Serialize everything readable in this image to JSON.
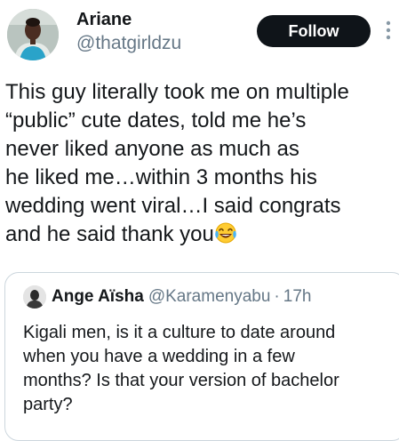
{
  "author": {
    "display_name": "Ariane",
    "handle": "@thatgirldzu",
    "avatar_icon": "profile-photo"
  },
  "follow_button": {
    "label": "Follow"
  },
  "more_menu_icon": "vertical-dots-icon",
  "tweet": {
    "lines": [
      "This guy literally took me on multiple",
      "“public” cute dates, told me he’s",
      "never liked anyone as much as",
      "he liked me…within 3 months his",
      "wedding went viral…I said congrats",
      "and he said thank you"
    ],
    "emoji": "face-with-tears-of-joy"
  },
  "quoted_tweet": {
    "display_name": "Ange Aïsha",
    "handle": "@Karamenyabu",
    "separator": "·",
    "time": "17h",
    "lines": [
      "Kigali men, is it a culture to date around",
      "when you have a wedding in  a few",
      "months? Is that your version of bachelor",
      "party?"
    ]
  },
  "colors": {
    "text": "#14171a",
    "secondary": "#657786",
    "follow_bg": "#0f1419",
    "border": "#ccd6dd"
  }
}
